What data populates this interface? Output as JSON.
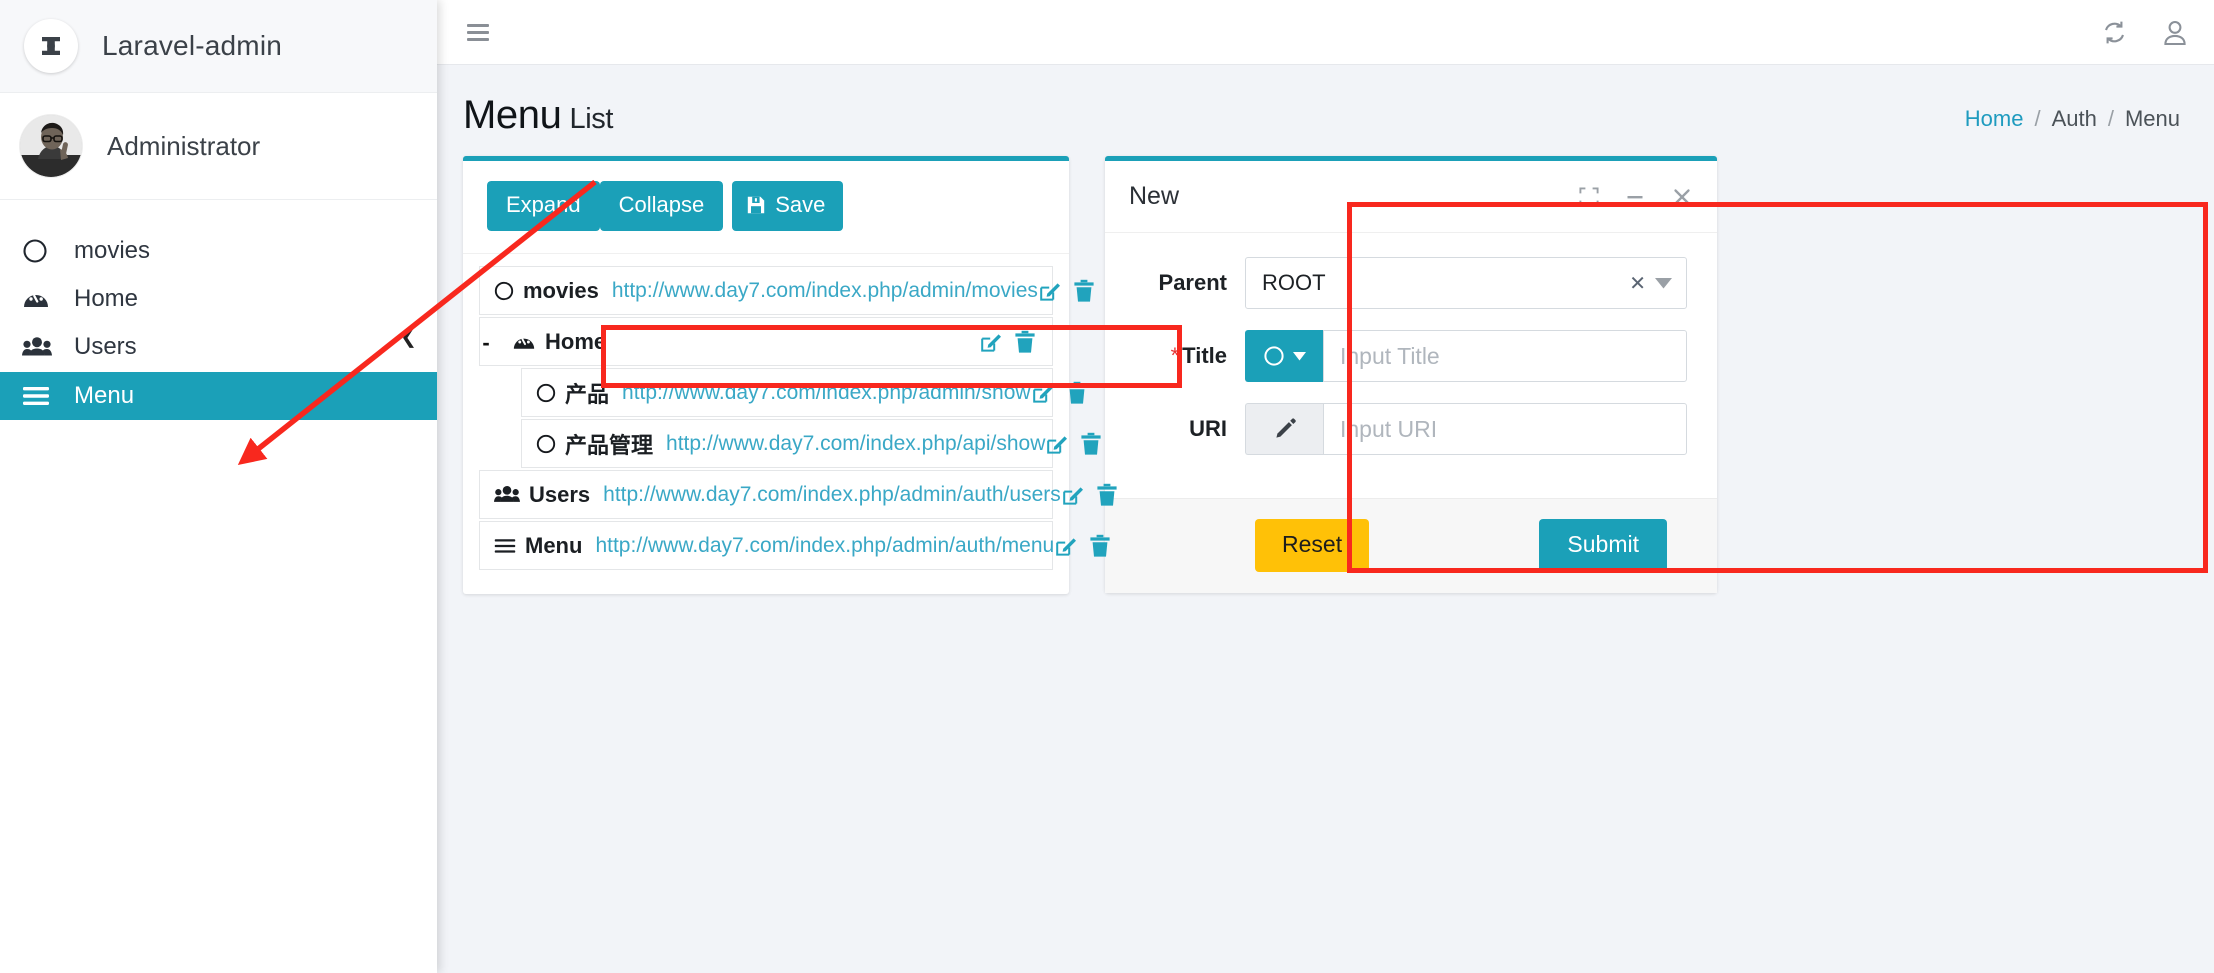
{
  "sidebar": {
    "brand": {
      "name": "Laravel-admin",
      "logo_icon": "laravel-logo-icon"
    },
    "user": {
      "name": "Administrator",
      "avatar_icon": "user-avatar"
    },
    "collapse_icon": "chevron-left-icon",
    "items": [
      {
        "label": "movies",
        "icon": "circle-icon",
        "active": false
      },
      {
        "label": "Home",
        "icon": "dashboard-icon",
        "active": false
      },
      {
        "label": "Users",
        "icon": "users-icon",
        "active": false
      },
      {
        "label": "Menu",
        "icon": "bars-icon",
        "active": true
      }
    ],
    "active_color": "#1ba0b8"
  },
  "topbar": {
    "menu_toggle_icon": "hamburger-icon",
    "refresh_icon": "refresh-icon",
    "user_icon": "user-icon"
  },
  "page": {
    "title": "Menu",
    "subtitle": "List",
    "breadcrumb": [
      {
        "label": "Home",
        "link": true
      },
      {
        "label": "Auth",
        "link": false
      },
      {
        "label": "Menu",
        "link": false
      }
    ],
    "breadcrumb_separator": "/"
  },
  "tree_panel": {
    "toolbar": {
      "expand_label": "Expand",
      "collapse_label": "Collapse",
      "save_label": "Save",
      "save_icon": "floppy-save-icon"
    },
    "rows": [
      {
        "label": "movies",
        "icon": "circle-icon",
        "url": "http://www.day7.com/index.php/admin/movies",
        "indent": 0,
        "marker": "",
        "edit_icon": "edit-icon",
        "delete_icon": "trash-icon"
      },
      {
        "label": "Home",
        "icon": "dashboard-icon",
        "url": "",
        "indent": 0,
        "marker": "-",
        "edit_icon": "edit-icon",
        "delete_icon": "trash-icon"
      },
      {
        "label": "产品",
        "icon": "circle-icon",
        "url": "http://www.day7.com/index.php/admin/show",
        "indent": 1,
        "marker": "",
        "edit_icon": "edit-icon",
        "delete_icon": "trash-icon"
      },
      {
        "label": "产品管理",
        "icon": "circle-icon",
        "url": "http://www.day7.com/index.php/api/show",
        "indent": 1,
        "marker": "",
        "edit_icon": "edit-icon",
        "delete_icon": "trash-icon"
      },
      {
        "label": "Users",
        "icon": "users-icon",
        "url": "http://www.day7.com/index.php/admin/auth/users",
        "indent": 0,
        "marker": "",
        "edit_icon": "edit-icon",
        "delete_icon": "trash-icon"
      },
      {
        "label": "Menu",
        "icon": "bars-icon",
        "url": "http://www.day7.com/index.php/admin/auth/menu",
        "indent": 0,
        "marker": "",
        "edit_icon": "edit-icon",
        "delete_icon": "trash-icon"
      }
    ]
  },
  "form_panel": {
    "title": "New",
    "tools": {
      "expand_icon": "fullscreen-icon",
      "minimize_icon": "minimize-icon",
      "close_icon": "close-icon"
    },
    "fields": {
      "parent": {
        "label": "Parent",
        "value": "ROOT",
        "clear_icon": "clear-x-icon",
        "caret_icon": "caret-down-icon"
      },
      "title": {
        "label": "Title",
        "required": true,
        "required_mark": "*",
        "value": "",
        "placeholder": "Input Title",
        "addon_icon": "circle-icon",
        "addon_caret_icon": "caret-down-icon"
      },
      "uri": {
        "label": "URI",
        "value": "",
        "placeholder": "Input URI",
        "addon_icon": "pencil-icon"
      }
    },
    "footer": {
      "reset_label": "Reset",
      "submit_label": "Submit",
      "reset_color": "#ffc107",
      "submit_color": "#1ba0b8"
    }
  },
  "annotations": {
    "highlight_color": "#f8281e",
    "url_highlight": "http://www.day7.com/index.php/admin/movies",
    "form_highlight": "New",
    "arrow_target": "Menu"
  },
  "theme": {
    "accent": "#1ba0b8",
    "page_bg": "#f2f4f8",
    "link": "#3aa8c6"
  }
}
